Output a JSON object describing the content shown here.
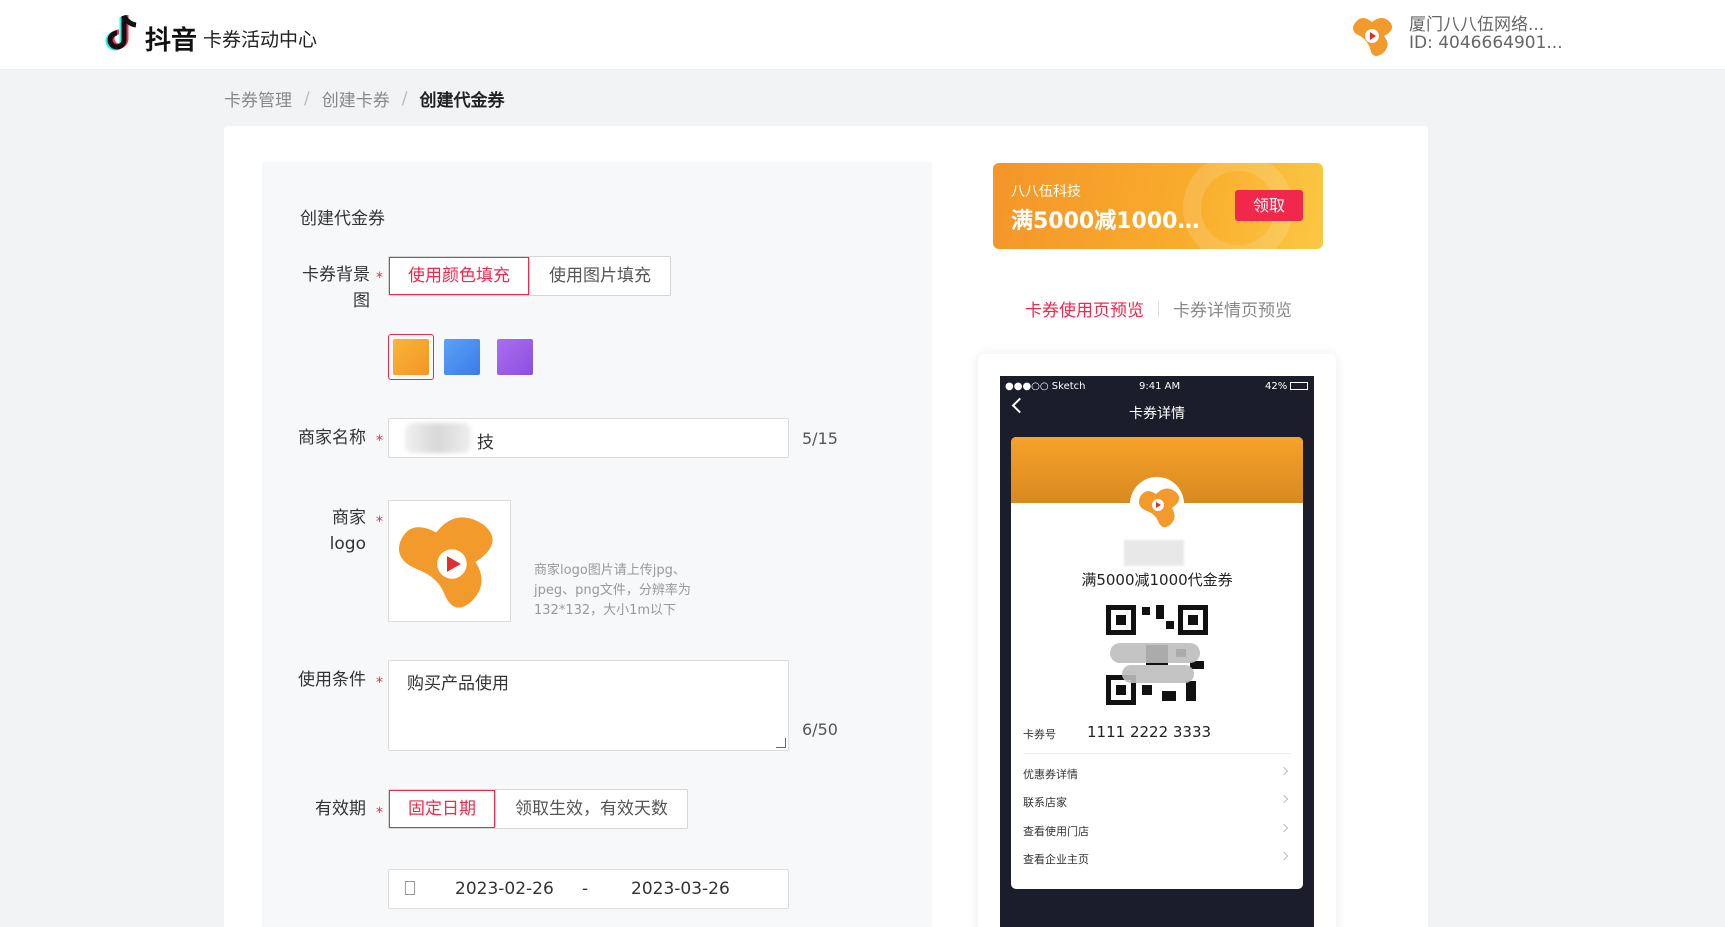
{
  "header": {
    "brand": "抖音",
    "subtitle": "卡券活动中心",
    "account_name": "厦门八八伍网络...",
    "account_id": "ID: 4046664901..."
  },
  "breadcrumb": [
    "卡券管理",
    "创建卡券",
    "创建代金券"
  ],
  "breadcrumb_sep": "/",
  "form": {
    "title": "创建代金券",
    "required_mark": "*",
    "background": {
      "label": "卡券背景图",
      "options": [
        "使用颜色填充",
        "使用图片填充"
      ],
      "selected": "使用颜色填充",
      "swatches": [
        "#f7a42c",
        "#4a8ef0",
        "#9b5de5"
      ],
      "selected_swatch": 0
    },
    "merchant_name": {
      "label": "商家名称",
      "value_visible": "技",
      "counter": "5/15"
    },
    "merchant_logo": {
      "label": "商家logo",
      "hint": "商家logo图片请上传jpg、jpeg、png文件，分辨率为132*132，大小1m以下"
    },
    "conditions": {
      "label": "使用条件",
      "value": "购买产品使用",
      "counter": "6/50"
    },
    "validity": {
      "label": "有效期",
      "options": [
        "固定日期",
        "领取生效，有效天数"
      ],
      "selected": "固定日期",
      "start": "2023-02-26",
      "range_sep": "-",
      "end": "2023-03-26"
    }
  },
  "coupon_preview": {
    "brand": "八八伍科技",
    "title": "满5000减1000代...",
    "button": "领取"
  },
  "preview_tabs": [
    "卡券使用页预览",
    "卡券详情页预览"
  ],
  "preview_tab_active": 0,
  "phone": {
    "status_left": "●●●○○ Sketch",
    "status_time": "9:41 AM",
    "status_battery": "42%",
    "nav_title": "卡券详情",
    "coupon_title": "满5000减1000代金券",
    "code_label": "卡券号",
    "code_value": "1111 2222 3333",
    "menu": [
      "优惠券详情",
      "联系店家",
      "查看使用门店",
      "查看企业主页"
    ]
  },
  "colors": {
    "accent": "#f0284b",
    "coupon_orange": "#f7a42c",
    "page_bg": "#f2f3f5"
  }
}
